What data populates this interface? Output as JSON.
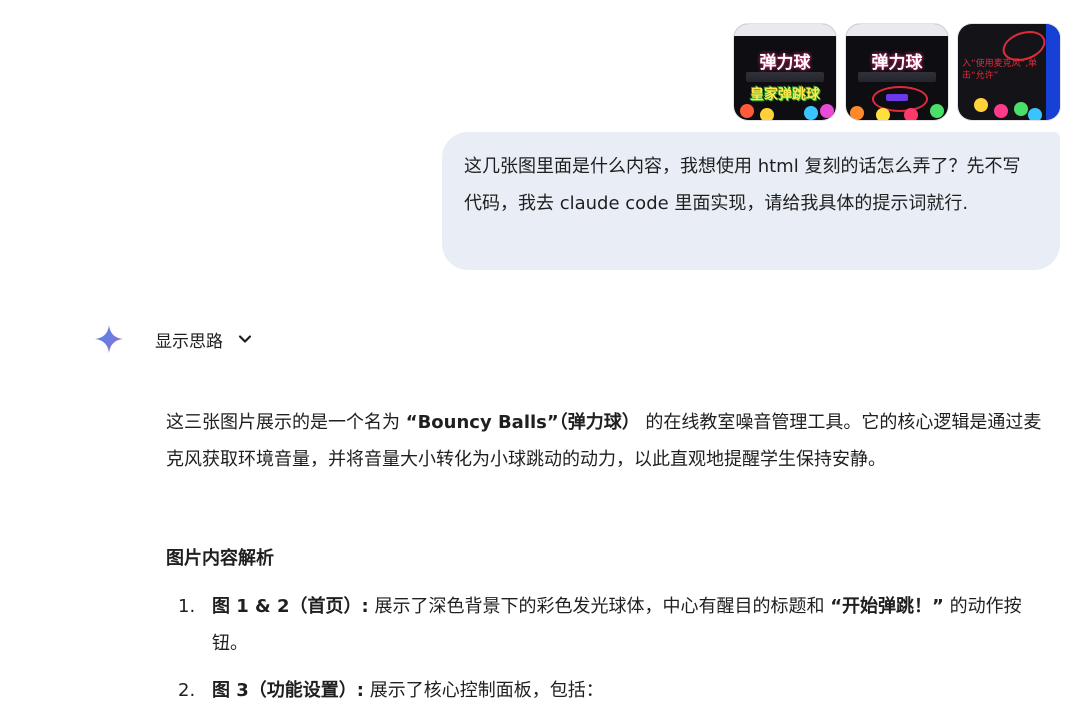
{
  "images": [
    {
      "title": "弹力球",
      "banner": "皇家弹跳球",
      "variant": "home"
    },
    {
      "title": "弹力球",
      "banner": "",
      "variant": "home-button"
    },
    {
      "title": "",
      "overlay_text": "入“使用麦克风”,单击“允许”",
      "variant": "settings"
    }
  ],
  "user_message": {
    "text": "这几张图里面是什么内容，我想使用 html 复刻的话怎么弄了？先不写代码，我去 claude code 里面实现，请给我具体的提示词就行."
  },
  "thinking": {
    "label": "显示思路",
    "icon": "sparkle-icon",
    "toggle_icon": "chevron-down-icon"
  },
  "answer": {
    "intro_1": "这三张图片展示的是一个名为 ",
    "intro_bold": "“Bouncy Balls”（弹力球）",
    "intro_2": " 的在线教室噪音管理工具。它的核心逻辑是通过麦克风获取环境音量，并将音量大小转化为小球跳动的动力，以此直观地提醒学生保持安静。",
    "heading": "图片内容解析",
    "items": [
      {
        "num": "1.",
        "bold": "图 1 & 2（首页）:",
        "text_1": " 展示了深色背景下的彩色发光球体，中心有醒目的标题和 ",
        "bold_2": "“开始弹跳！”",
        "text_2": " 的动作按钮。"
      },
      {
        "num": "2.",
        "bold": "图 3（功能设置）:",
        "text_1": " 展示了核心控制面板，包括：",
        "bold_2": "",
        "text_2": ""
      }
    ]
  },
  "colors": {
    "bubble_bg": "#e9eef6",
    "spark_blue": "#4285f4",
    "spark_purple": "#9b72cb"
  }
}
